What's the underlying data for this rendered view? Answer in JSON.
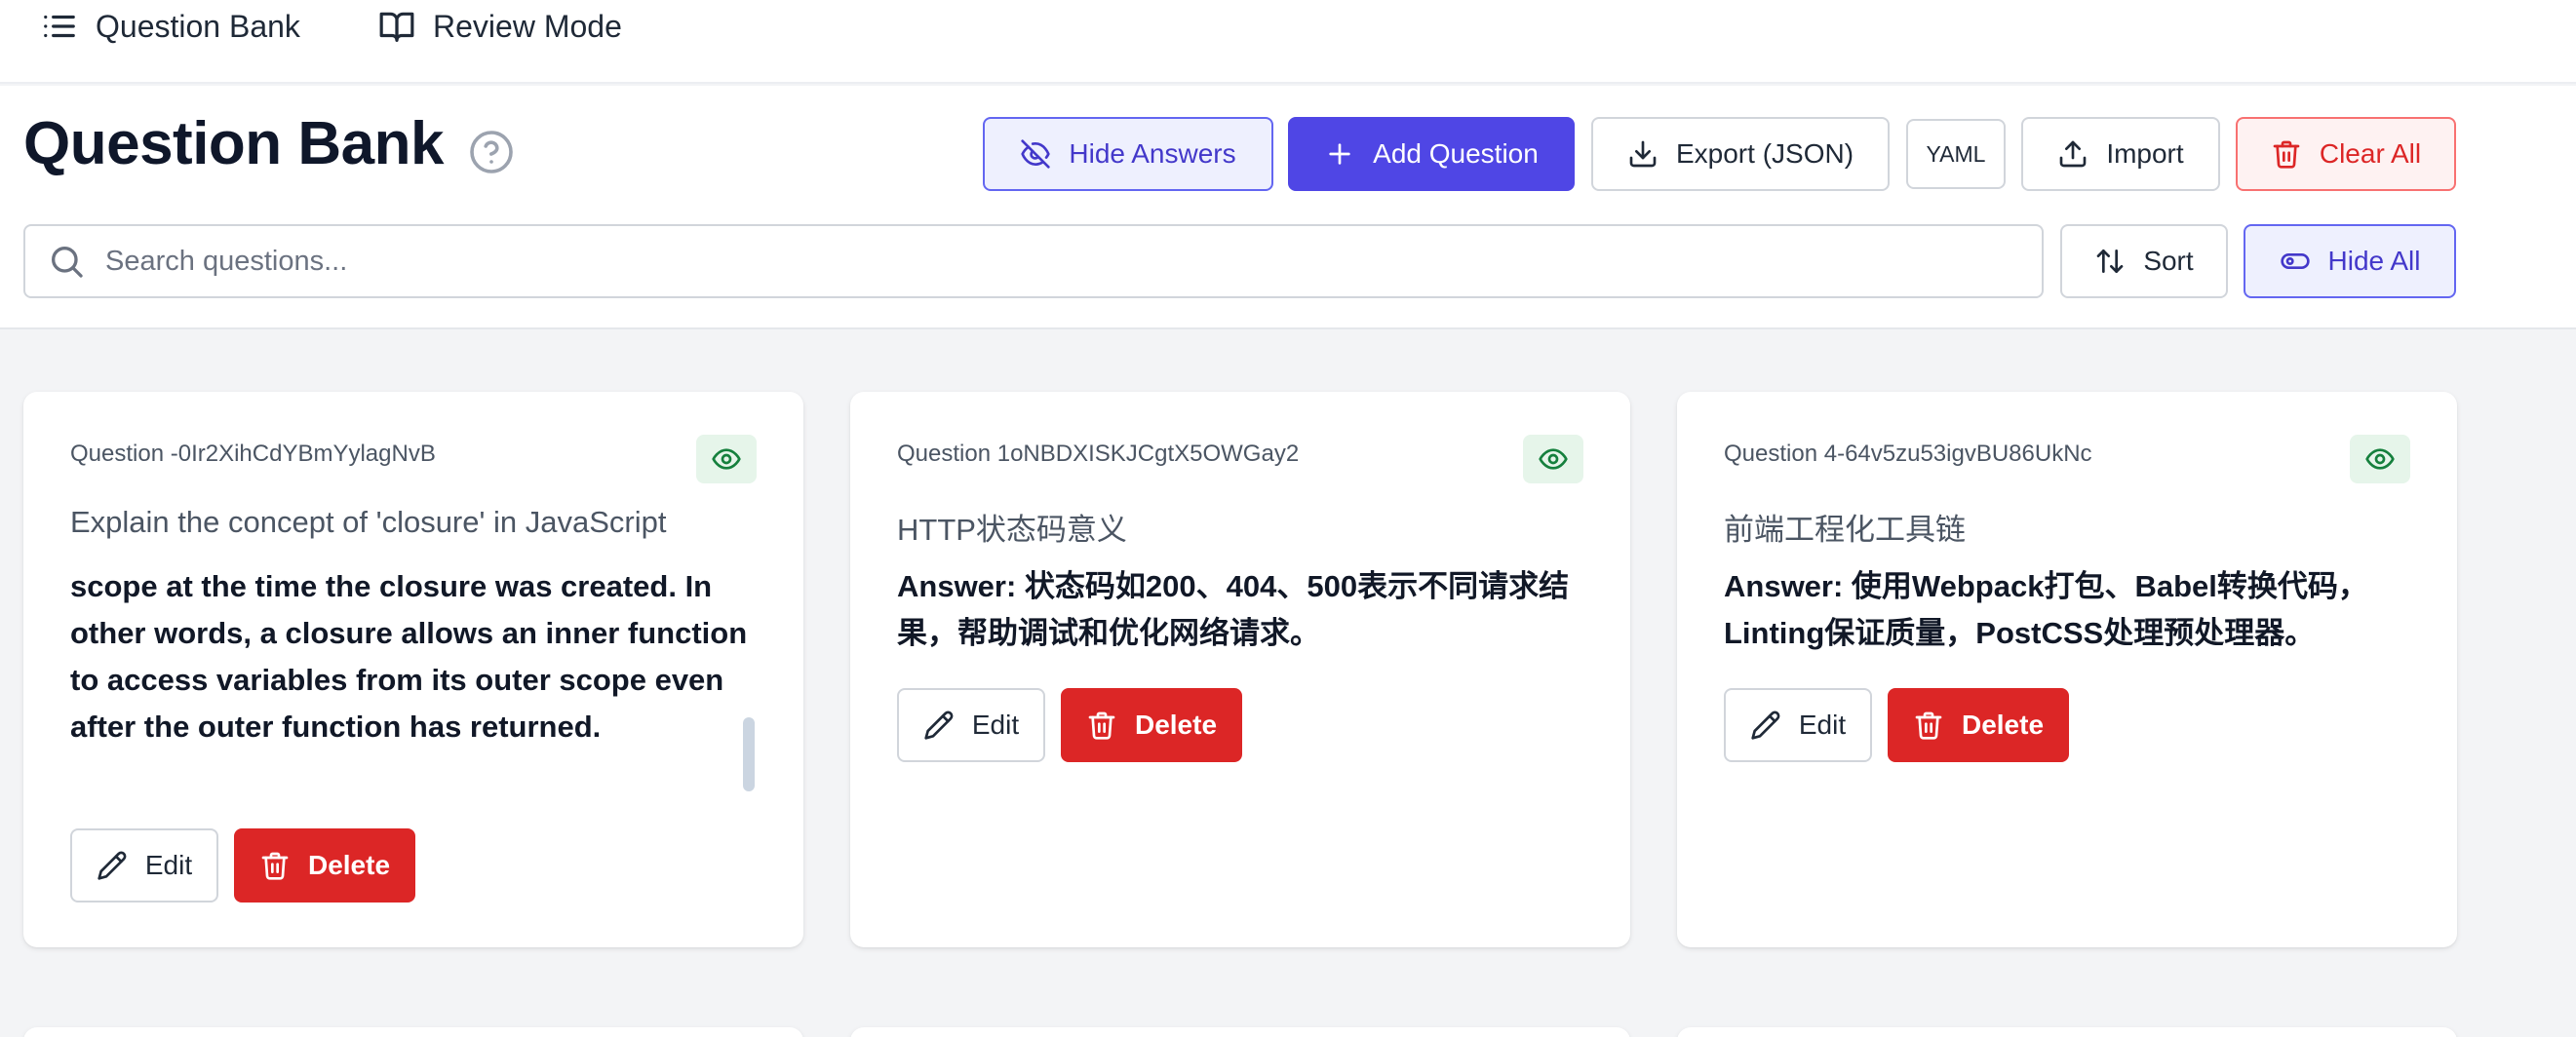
{
  "nav": {
    "items": [
      {
        "label": "Question Bank",
        "icon": "list-icon"
      },
      {
        "label": "Review Mode",
        "icon": "book-open-icon"
      }
    ]
  },
  "header": {
    "title": "Question Bank",
    "help_icon": "help-circle-icon"
  },
  "toolbar": {
    "hide_answers": "Hide Answers",
    "add_question": "Add Question",
    "export_json": "Export (JSON)",
    "yaml": "YAML",
    "import": "Import",
    "clear_all": "Clear All",
    "sort": "Sort",
    "hide_all": "Hide All"
  },
  "search": {
    "placeholder": "Search questions...",
    "value": ""
  },
  "colors": {
    "accent": "#4f46e5",
    "danger": "#dc2626",
    "visible_badge": "#15803d",
    "background": "#f3f4f6"
  },
  "cards": [
    {
      "id": "Question -0Ir2XihCdYBmYylagNvB",
      "question": "Explain the concept of 'closure' in JavaScript",
      "answer": "scope at the time the closure was created. In other words, a closure allows an inner function to access variables from its outer scope even after the outer function has returned.",
      "edit_label": "Edit",
      "delete_label": "Delete"
    },
    {
      "id": "Question 1oNBDXISKJCgtX5OWGay2",
      "question": "HTTP状态码意义",
      "answer": "Answer: 状态码如200、404、500表示不同请求结果，帮助调试和优化网络请求。",
      "edit_label": "Edit",
      "delete_label": "Delete"
    },
    {
      "id": "Question 4-64v5zu53igvBU86UkNc",
      "question": "前端工程化工具链",
      "answer": "Answer: 使用Webpack打包、Babel转换代码，Linting保证质量，PostCSS处理预处理器。",
      "edit_label": "Edit",
      "delete_label": "Delete"
    }
  ]
}
